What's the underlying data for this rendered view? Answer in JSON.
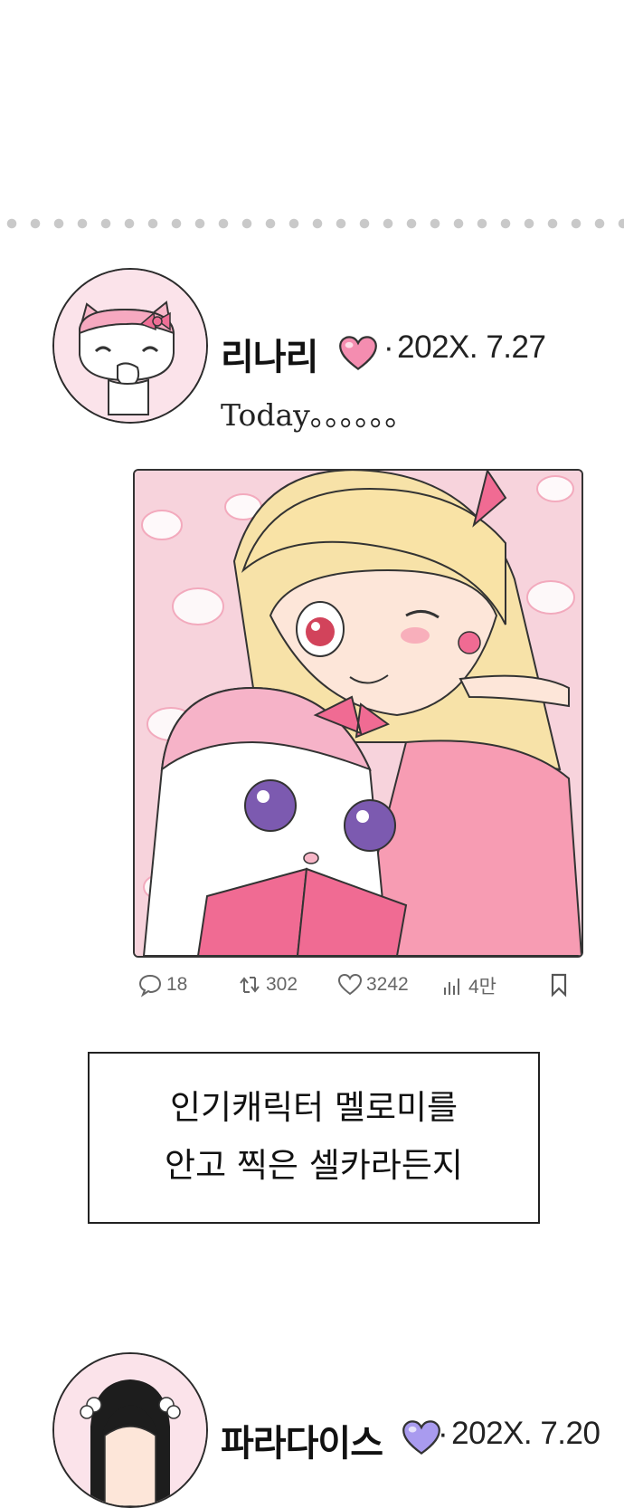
{
  "posts": [
    {
      "author": "리나리",
      "date": "202X. 7.27",
      "text": "Today。。。。。。",
      "stats": {
        "comments": "18",
        "reposts": "302",
        "likes": "3242",
        "views": "4만"
      }
    },
    {
      "author": "파라다이스",
      "date": "202X. 7.20"
    }
  ],
  "caption": {
    "line1": "인기캐릭터 멜로미를",
    "line2": "안고 찍은 셀카라든지"
  },
  "colors": {
    "accent_pink": "#f06b93",
    "heart_pink": "#f26d96",
    "heart_purple": "#9b8fe6",
    "divider_dots": "#c9c9c9"
  },
  "icons": [
    "comment-icon",
    "repost-icon",
    "heart-outline-icon",
    "views-icon",
    "bookmark-icon"
  ]
}
